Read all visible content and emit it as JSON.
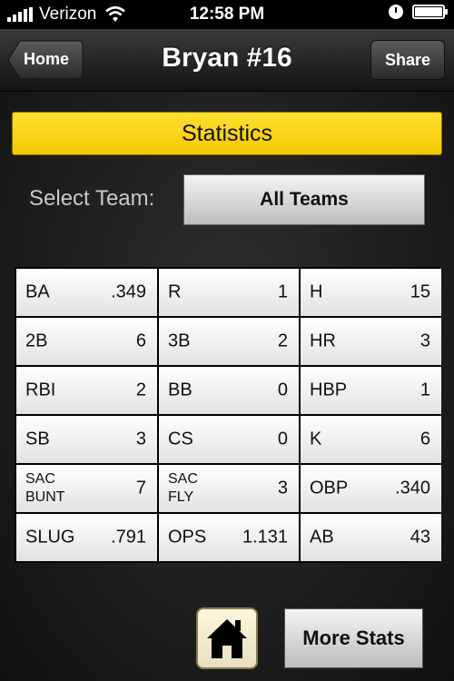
{
  "status_bar": {
    "carrier": "Verizon",
    "time": "12:58 PM"
  },
  "nav": {
    "back_label": "Home",
    "title": "Bryan #16",
    "share_label": "Share"
  },
  "stats_header": "Statistics",
  "team_select": {
    "label": "Select Team:",
    "value": "All Teams"
  },
  "stats": [
    [
      {
        "label": "BA",
        "value": ".349"
      },
      {
        "label": "R",
        "value": "1"
      },
      {
        "label": "H",
        "value": "15"
      }
    ],
    [
      {
        "label": "2B",
        "value": "6"
      },
      {
        "label": "3B",
        "value": "2"
      },
      {
        "label": "HR",
        "value": "3"
      }
    ],
    [
      {
        "label": "RBI",
        "value": "2"
      },
      {
        "label": "BB",
        "value": "0"
      },
      {
        "label": "HBP",
        "value": "1"
      }
    ],
    [
      {
        "label": "SB",
        "value": "3"
      },
      {
        "label": "CS",
        "value": "0"
      },
      {
        "label": "K",
        "value": "6"
      }
    ],
    [
      {
        "label": "SAC BUNT",
        "value": "7"
      },
      {
        "label": "SAC FLY",
        "value": "3"
      },
      {
        "label": "OBP",
        "value": ".340"
      }
    ],
    [
      {
        "label": "SLUG",
        "value": ".791"
      },
      {
        "label": "OPS",
        "value": "1.131"
      },
      {
        "label": "AB",
        "value": "43"
      }
    ]
  ],
  "footer": {
    "more_stats_label": "More Stats"
  },
  "icons": {
    "home": "house-icon"
  },
  "colors": {
    "accent": "#f5c800"
  }
}
